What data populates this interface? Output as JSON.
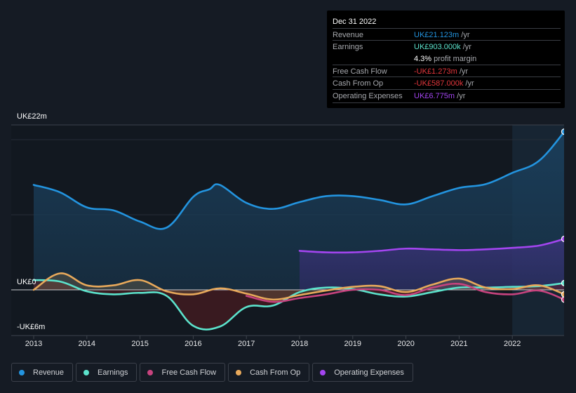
{
  "tooltip": {
    "date": "Dec 31 2022",
    "rows": [
      {
        "label": "Revenue",
        "value": "UK£21.123m",
        "unit": " /yr",
        "color": "#2394df"
      },
      {
        "label": "Earnings",
        "value": "UK£903.000k",
        "unit": " /yr",
        "color": "#5ce3cc"
      },
      {
        "label": "",
        "value": "4.3%",
        "unit": " profit margin",
        "color": "#ffffff"
      },
      {
        "label": "Free Cash Flow",
        "value": "-UK£1.273m",
        "unit": " /yr",
        "color": "#e3363c"
      },
      {
        "label": "Cash From Op",
        "value": "-UK£587.000k",
        "unit": " /yr",
        "color": "#e3363c"
      },
      {
        "label": "Operating Expenses",
        "value": "UK£6.775m",
        "unit": " /yr",
        "color": "#a345f0"
      }
    ]
  },
  "chart_data": {
    "type": "line",
    "title": "",
    "xlabel": "",
    "ylabel": "",
    "ylim": [
      -6,
      22
    ],
    "y_tick_labels": [
      {
        "value": 22,
        "label": "UK£22m"
      },
      {
        "value": 0,
        "label": "UK£0"
      },
      {
        "value": -6,
        "label": "-UK£6m"
      }
    ],
    "x_ticks": [
      "2013",
      "2014",
      "2015",
      "2016",
      "2017",
      "2018",
      "2019",
      "2020",
      "2021",
      "2022"
    ],
    "xlim": [
      2012.55,
      2022.98
    ],
    "highlight_region": [
      2022.0,
      2022.98
    ],
    "legend_position": "bottom-left",
    "series": [
      {
        "name": "Revenue",
        "color": "#2394df",
        "x": [
          2013.0,
          2013.5,
          2014.0,
          2014.5,
          2015.0,
          2015.5,
          2016.0,
          2016.3,
          2016.5,
          2017.0,
          2017.5,
          2018.0,
          2018.5,
          2019.0,
          2019.5,
          2020.0,
          2020.5,
          2021.0,
          2021.5,
          2022.0,
          2022.5,
          2022.98
        ],
        "values": [
          14.0,
          13.0,
          11.0,
          10.6,
          9.1,
          8.3,
          12.4,
          13.4,
          14.0,
          11.6,
          10.8,
          11.7,
          12.5,
          12.5,
          12.0,
          11.4,
          12.5,
          13.6,
          14.1,
          15.6,
          17.2,
          21.1
        ]
      },
      {
        "name": "Earnings",
        "color": "#5ce3cc",
        "x": [
          2013.0,
          2013.5,
          2014.0,
          2014.5,
          2015.0,
          2015.5,
          2016.0,
          2016.5,
          2017.0,
          2017.5,
          2018.0,
          2018.5,
          2019.0,
          2019.5,
          2020.0,
          2020.5,
          2021.0,
          2021.5,
          2022.0,
          2022.5,
          2022.98
        ],
        "values": [
          1.3,
          1.1,
          -0.2,
          -0.6,
          -0.4,
          -0.8,
          -4.8,
          -4.9,
          -2.3,
          -2.1,
          -0.3,
          0.3,
          0.1,
          -0.6,
          -0.9,
          -0.3,
          0.3,
          0.3,
          0.4,
          0.5,
          0.9
        ]
      },
      {
        "name": "Free Cash Flow",
        "color": "#c7437e",
        "x": [
          2017.0,
          2017.5,
          2018.0,
          2018.5,
          2019.0,
          2019.5,
          2020.0,
          2020.5,
          2021.0,
          2021.5,
          2022.0,
          2022.5,
          2022.98
        ],
        "values": [
          -0.8,
          -1.6,
          -1.1,
          -0.6,
          0.0,
          0.0,
          -0.7,
          0.3,
          0.8,
          -0.3,
          -0.6,
          -0.1,
          -1.3
        ]
      },
      {
        "name": "Cash From Op",
        "color": "#e8a95b",
        "x": [
          2013.0,
          2013.5,
          2014.0,
          2014.5,
          2015.0,
          2015.5,
          2016.0,
          2016.5,
          2017.0,
          2017.5,
          2018.0,
          2018.5,
          2019.0,
          2019.5,
          2020.0,
          2020.5,
          2021.0,
          2021.5,
          2022.0,
          2022.5,
          2022.98
        ],
        "values": [
          0.0,
          2.2,
          0.6,
          0.6,
          1.3,
          -0.2,
          -0.6,
          0.2,
          -0.5,
          -1.3,
          -0.7,
          -0.1,
          0.4,
          0.5,
          -0.3,
          0.7,
          1.5,
          0.3,
          0.1,
          0.6,
          -0.6
        ]
      },
      {
        "name": "Operating Expenses",
        "color": "#a345f0",
        "x": [
          2018.0,
          2018.5,
          2019.0,
          2019.5,
          2020.0,
          2020.5,
          2021.0,
          2021.5,
          2022.0,
          2022.5,
          2022.98
        ],
        "values": [
          5.2,
          5.0,
          5.0,
          5.2,
          5.5,
          5.4,
          5.3,
          5.4,
          5.6,
          5.9,
          6.8
        ]
      }
    ]
  },
  "legend": [
    {
      "label": "Revenue",
      "color": "#2394df"
    },
    {
      "label": "Earnings",
      "color": "#5ce3cc"
    },
    {
      "label": "Free Cash Flow",
      "color": "#c7437e"
    },
    {
      "label": "Cash From Op",
      "color": "#e8a95b"
    },
    {
      "label": "Operating Expenses",
      "color": "#a345f0"
    }
  ]
}
